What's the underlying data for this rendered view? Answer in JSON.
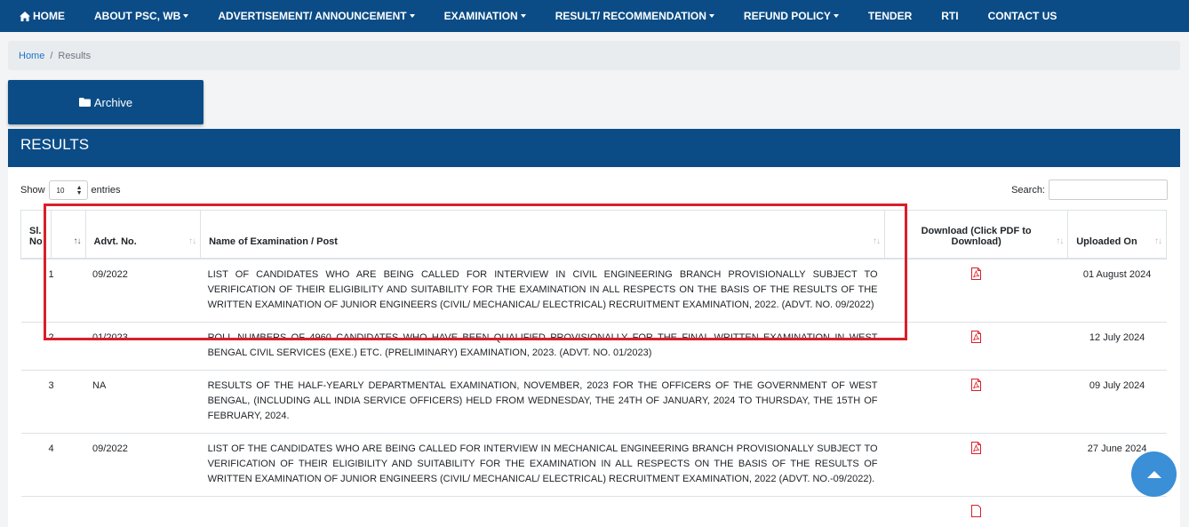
{
  "nav": {
    "home": "HOME",
    "about": "ABOUT PSC, WB",
    "advertisement": "ADVERTISEMENT/ ANNOUNCEMENT",
    "examination": "EXAMINATION",
    "result": "RESULT/ RECOMMENDATION",
    "refund": "REFUND POLICY",
    "tender": "TENDER",
    "rti": "RTI",
    "contact": "CONTACT US"
  },
  "breadcrumb": {
    "home": "Home",
    "separator": "/",
    "current": "Results"
  },
  "archive_label": "Archive",
  "panel_title": "RESULTS",
  "controls": {
    "show": "Show",
    "entries_value": "10",
    "entries": "entries",
    "search": "Search:"
  },
  "table": {
    "headers": {
      "sl_line1": "Sl.",
      "sl_line2": "No",
      "advt": "Advt. No.",
      "name": "Name of Examination / Post",
      "download_line1": "Download (Click PDF to",
      "download_line2": "Download)",
      "uploaded": "Uploaded On"
    },
    "rows": [
      {
        "sl": "1",
        "advt": "09/2022",
        "name": "LIST OF CANDIDATES WHO ARE BEING CALLED FOR INTERVIEW IN CIVIL ENGINEERING BRANCH PROVISIONALLY SUBJECT TO VERIFICATION OF THEIR ELIGIBILITY AND SUITABILITY FOR THE EXAMINATION IN ALL RESPECTS ON THE BASIS OF THE RESULTS OF THE WRITTEN EXAMINATION OF JUNIOR ENGINEERS (CIVIL/ MECHANICAL/ ELECTRICAL) RECRUITMENT EXAMINATION, 2022. (ADVT. NO. 09/2022)",
        "uploaded": "01 August 2024"
      },
      {
        "sl": "2",
        "advt": "01/2023",
        "name": "ROLL NUMBERS OF 4960 CANDIDATES WHO HAVE BEEN QUALIFIED PROVISIONALLY FOR THE FINAL WRITTEN EXAMINATION IN WEST BENGAL CIVIL SERVICES (EXE.) ETC. (PRELIMINARY) EXAMINATION, 2023. (ADVT. NO. 01/2023)",
        "uploaded": "12 July 2024"
      },
      {
        "sl": "3",
        "advt": "NA",
        "name": "RESULTS OF THE HALF-YEARLY DEPARTMENTAL EXAMINATION, NOVEMBER, 2023 FOR THE OFFICERS OF THE GOVERNMENT OF WEST BENGAL, (INCLUDING ALL INDIA SERVICE OFFICERS) HELD FROM WEDNESDAY, THE 24TH OF JANUARY, 2024 TO THURSDAY, THE 15TH OF FEBRUARY, 2024.",
        "uploaded": "09 July 2024"
      },
      {
        "sl": "4",
        "advt": "09/2022",
        "name": "LIST OF THE CANDIDATES WHO ARE BEING CALLED FOR INTERVIEW IN MECHANICAL ENGINEERING BRANCH PROVISIONALLY SUBJECT TO VERIFICATION OF THEIR ELIGIBILITY AND SUITABILITY FOR THE EXAMINATION IN ALL RESPECTS ON THE BASIS OF THE RESULTS OF WRITTEN EXAMINATION OF JUNIOR ENGINEERS (CIVIL/ MECHANICAL/ ELECTRICAL) RECRUITMENT EXAMINATION, 2022 (ADVT. NO.-09/2022).",
        "uploaded": "27 June 2024"
      },
      {
        "sl": "",
        "advt": "",
        "name": "",
        "uploaded": ""
      }
    ]
  },
  "icons": {
    "home": "home-icon",
    "folder": "folder-icon",
    "pdf": "pdf-icon",
    "scroll_top": "arrow-up-icon"
  },
  "colors": {
    "primary": "#0b4c86",
    "highlight": "#d7202a",
    "pdf": "#d7202a",
    "scroll_button": "#3a8fd6"
  }
}
